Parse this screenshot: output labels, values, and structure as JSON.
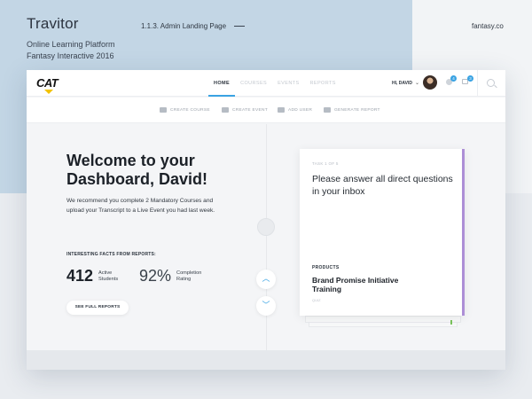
{
  "studio": {
    "title": "Travitor",
    "subtitle_line1": "Online Learning Platform",
    "subtitle_line2": "Fantasy Interactive 2016",
    "shot_label": "1.1.3. Admin Landing Page",
    "site": "fantasy.co"
  },
  "header": {
    "logo": "CAT",
    "nav": [
      {
        "label": "HOME",
        "active": true
      },
      {
        "label": "COURSES",
        "active": false
      },
      {
        "label": "EVENTS",
        "active": false
      },
      {
        "label": "REPORTS",
        "active": false
      }
    ],
    "greeting": "HI, DAVID",
    "notifications_count": "4",
    "cart_count": "3"
  },
  "actions": [
    {
      "label": "CREATE COURSE"
    },
    {
      "label": "CREATE EVENT"
    },
    {
      "label": "ADD USER"
    },
    {
      "label": "GENERATE REPORT"
    }
  ],
  "main": {
    "welcome_line1": "Welcome to your",
    "welcome_line2": "Dashboard, David!",
    "intro": "We recommend you complete 2 Mandatory Courses and upload your Transcript to a Live Event you had last week.",
    "facts_label": "INTERESTING FACTS FROM REPORTS:",
    "stats": [
      {
        "value": "412",
        "label_line1": "Active",
        "label_line2": "Students"
      },
      {
        "value": "92%",
        "label_line1": "Completion",
        "label_line2": "Rating"
      }
    ],
    "report_button": "SEE FULL REPORTS"
  },
  "card": {
    "task_label": "TASK 1 OF 5",
    "question": "Please answer all direct questions in your inbox",
    "product_label": "PRODUCTS",
    "product_title": "Brand Promise Initiative Training",
    "product_sub": "QUIZ",
    "accent_color": "#ad8fd6"
  },
  "icons": {
    "up": "chevron-up-icon",
    "down": "chevron-down-icon",
    "search": "search-icon"
  }
}
